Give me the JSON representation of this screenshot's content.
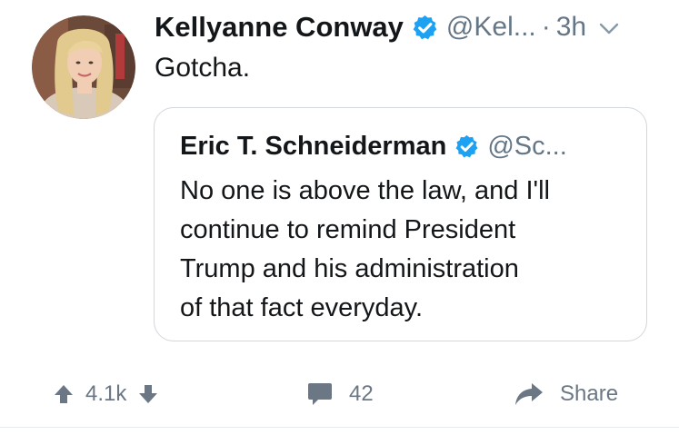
{
  "tweet": {
    "author": {
      "display_name": "Kellyanne Conway",
      "verified": true,
      "handle": "@Kel...",
      "avatar_icon": "profile-photo"
    },
    "separator": "·",
    "time": "3h",
    "text": "Gotcha.",
    "menu_icon": "chevron-down-icon"
  },
  "quoted_tweet": {
    "author": {
      "display_name": "Eric T. Schneiderman",
      "verified": true,
      "handle": "@Sc..."
    },
    "lines": [
      "No one is above the law, and I'll",
      "continue to remind President",
      "Trump and his administration",
      "of that fact everyday."
    ]
  },
  "actions": {
    "score": "4.1k",
    "upvote_icon": "arrow-up-icon",
    "downvote_icon": "arrow-down-icon",
    "comments_icon": "comment-bubble-icon",
    "comments_count": "42",
    "share_icon": "share-arrow-icon",
    "share_label": "Share"
  },
  "colors": {
    "verified": "#1da1f2",
    "text": "#14171a",
    "muted": "#657786",
    "action": "#6b7785",
    "card_border": "#d0d7de"
  }
}
